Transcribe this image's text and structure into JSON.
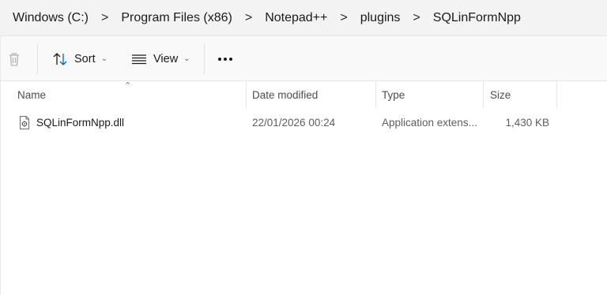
{
  "breadcrumb": {
    "items": [
      "Windows  (C:)",
      "Program Files (x86)",
      "Notepad++",
      "plugins",
      "SQLinFormNpp"
    ],
    "separator": ">"
  },
  "toolbar": {
    "sort_label": "Sort",
    "view_label": "View"
  },
  "columns": {
    "name": "Name",
    "date_modified": "Date modified",
    "type": "Type",
    "size": "Size"
  },
  "files": [
    {
      "name": "SQLinFormNpp.dll",
      "date_modified": "22/01/2026 00:24",
      "type": "Application extens...",
      "size": "1,430 KB",
      "icon": "dll-file-icon"
    }
  ],
  "colors": {
    "address_bg": "#f3f3f3",
    "toolbar_bg": "#f9f9f9",
    "accent": "#0067c0"
  }
}
